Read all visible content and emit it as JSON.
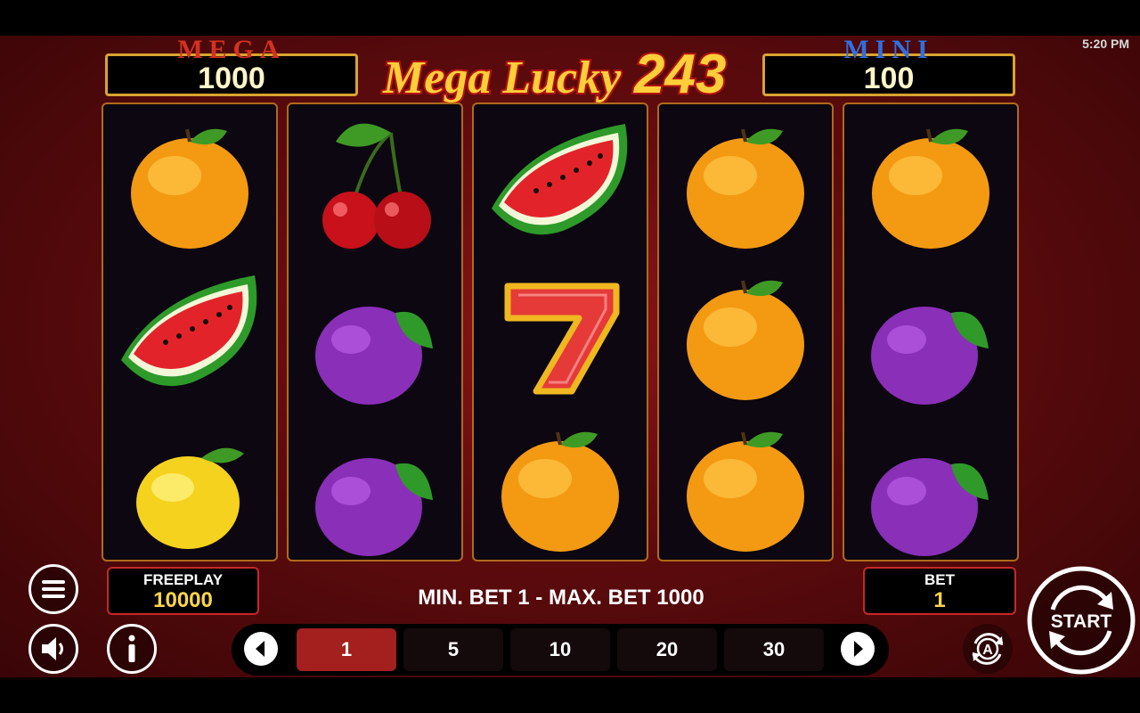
{
  "status_bar": {
    "time": "5:20 PM"
  },
  "jackpots": {
    "mega": {
      "title": "MEGA",
      "value": "1000"
    },
    "mini": {
      "title": "MINI",
      "value": "100"
    }
  },
  "game_title": {
    "line1": "Mega Lucky",
    "line2": "243"
  },
  "reels": [
    [
      "orange",
      "watermelon",
      "lemon"
    ],
    [
      "cherry",
      "plum",
      "plum"
    ],
    [
      "watermelon",
      "seven",
      "orange"
    ],
    [
      "orange",
      "orange",
      "orange"
    ],
    [
      "orange",
      "plum",
      "plum"
    ]
  ],
  "freeplay": {
    "label": "FREEPLAY",
    "value": "10000"
  },
  "bet_info": "MIN. BET 1 - MAX. BET 1000",
  "bet": {
    "label": "BET",
    "value": "1"
  },
  "bet_options": [
    "1",
    "5",
    "10",
    "20",
    "30"
  ],
  "selected_bet": "1",
  "start_label": "START",
  "autoplay_label": "A",
  "colors": {
    "accent": "#a3201f",
    "gold": "#d9a330",
    "mega_title": "#d3321f",
    "mini_title": "#2f6fe0"
  }
}
